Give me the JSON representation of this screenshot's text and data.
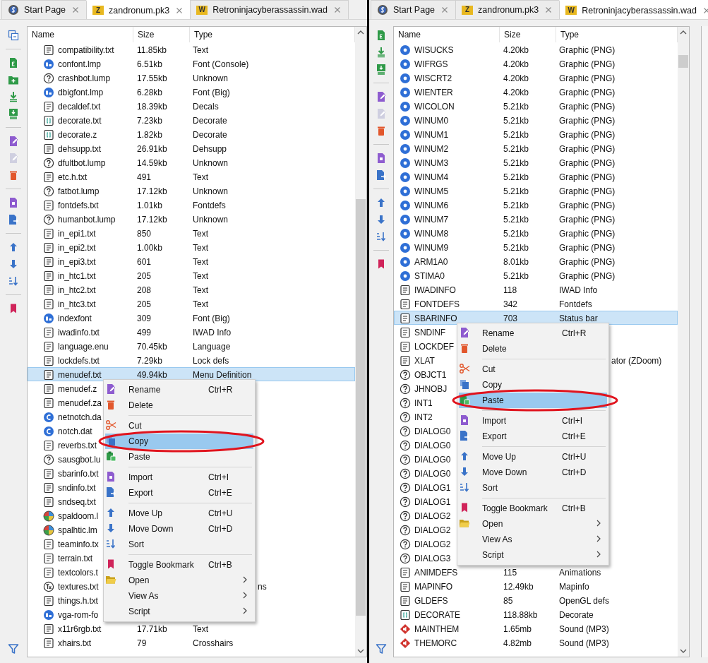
{
  "panels": [
    {
      "tabs": [
        {
          "kind": "start",
          "label": "Start Page",
          "selected": false
        },
        {
          "kind": "archive",
          "badge": "Z",
          "label": "zandronum.pk3",
          "selected": true
        },
        {
          "kind": "archive",
          "badge": "W",
          "label": "Retroninjacyberassassin.wad",
          "selected": false
        }
      ],
      "list": {
        "columns": [
          "Name",
          "Size",
          "Type"
        ],
        "rows": [
          {
            "kind": "text",
            "name": "compatibility.txt",
            "size": "11.85kb",
            "type": "Text",
            "selected": false
          },
          {
            "kind": "font",
            "name": "confont.lmp",
            "size": "6.51kb",
            "type": "Font (Console)",
            "selected": false
          },
          {
            "kind": "unknown",
            "name": "crashbot.lump",
            "size": "17.55kb",
            "type": "Unknown",
            "selected": false
          },
          {
            "kind": "font",
            "name": "dbigfont.lmp",
            "size": "6.28kb",
            "type": "Font (Big)",
            "selected": false
          },
          {
            "kind": "text",
            "name": "decaldef.txt",
            "size": "18.39kb",
            "type": "Decals",
            "selected": false
          },
          {
            "kind": "decorate",
            "name": "decorate.txt",
            "size": "7.23kb",
            "type": "Decorate",
            "selected": false
          },
          {
            "kind": "decorate",
            "name": "decorate.z",
            "size": "1.82kb",
            "type": "Decorate",
            "selected": false
          },
          {
            "kind": "text",
            "name": "dehsupp.txt",
            "size": "26.91kb",
            "type": "Dehsupp",
            "selected": false
          },
          {
            "kind": "unknown",
            "name": "dfultbot.lump",
            "size": "14.59kb",
            "type": "Unknown",
            "selected": false
          },
          {
            "kind": "text",
            "name": "etc.h.txt",
            "size": "491",
            "type": "Text",
            "selected": false
          },
          {
            "kind": "unknown",
            "name": "fatbot.lump",
            "size": "17.12kb",
            "type": "Unknown",
            "selected": false
          },
          {
            "kind": "text",
            "name": "fontdefs.txt",
            "size": "1.01kb",
            "type": "Fontdefs",
            "selected": false
          },
          {
            "kind": "unknown",
            "name": "humanbot.lump",
            "size": "17.12kb",
            "type": "Unknown",
            "selected": false
          },
          {
            "kind": "text",
            "name": "in_epi1.txt",
            "size": "850",
            "type": "Text",
            "selected": false
          },
          {
            "kind": "text",
            "name": "in_epi2.txt",
            "size": "1.00kb",
            "type": "Text",
            "selected": false
          },
          {
            "kind": "text",
            "name": "in_epi3.txt",
            "size": "601",
            "type": "Text",
            "selected": false
          },
          {
            "kind": "text",
            "name": "in_htc1.txt",
            "size": "205",
            "type": "Text",
            "selected": false
          },
          {
            "kind": "text",
            "name": "in_htc2.txt",
            "size": "208",
            "type": "Text",
            "selected": false
          },
          {
            "kind": "text",
            "name": "in_htc3.txt",
            "size": "205",
            "type": "Text",
            "selected": false
          },
          {
            "kind": "font",
            "name": "indexfont",
            "size": "309",
            "type": "Font (Big)",
            "selected": false
          },
          {
            "kind": "text",
            "name": "iwadinfo.txt",
            "size": "499",
            "type": "IWAD Info",
            "selected": false
          },
          {
            "kind": "text",
            "name": "language.enu",
            "size": "70.45kb",
            "type": "Language",
            "selected": false
          },
          {
            "kind": "text",
            "name": "lockdefs.txt",
            "size": "7.29kb",
            "type": "Lock defs",
            "selected": false
          },
          {
            "kind": "text",
            "name": "menudef.txt",
            "size": "49.94kb",
            "type": "Menu Definition",
            "selected": true
          },
          {
            "kind": "text",
            "name": "menudef.z",
            "selected": false
          },
          {
            "kind": "text",
            "name": "menudef.za",
            "selected": false
          },
          {
            "kind": "graphic",
            "name": "netnotch.da",
            "selected": false
          },
          {
            "kind": "graphic",
            "name": "notch.dat",
            "selected": false
          },
          {
            "kind": "text",
            "name": "reverbs.txt",
            "selected": false
          },
          {
            "kind": "unknown",
            "name": "sausgbot.lu",
            "selected": false
          },
          {
            "kind": "text",
            "name": "sbarinfo.txt",
            "selected": false
          },
          {
            "kind": "text",
            "name": "sndinfo.txt",
            "selected": false
          },
          {
            "kind": "text",
            "name": "sndseq.txt",
            "selected": false
          },
          {
            "kind": "palette",
            "name": "spaldoom.l",
            "selected": false
          },
          {
            "kind": "palette",
            "name": "spalhtic.lm",
            "selected": false
          },
          {
            "kind": "text",
            "name": "teaminfo.tx",
            "selected": false
          },
          {
            "kind": "text",
            "name": "terrain.txt",
            "selected": false
          },
          {
            "kind": "text",
            "name": "textcolors.t",
            "selected": false
          },
          {
            "kind": "textures",
            "name": "textures.txt",
            "type_end": "ns",
            "selected": false
          },
          {
            "kind": "text",
            "name": "things.h.txt",
            "selected": false
          },
          {
            "kind": "font",
            "name": "vga-rom-fo",
            "selected": false
          },
          {
            "kind": "text",
            "name": "x11r6rgb.txt",
            "size": "17.71kb",
            "type": "Text",
            "selected": false
          },
          {
            "kind": "text",
            "name": "xhairs.txt",
            "size": "79",
            "type": "Crosshairs",
            "selected": false
          }
        ]
      },
      "context_menu": {
        "items": [
          {
            "kind": "item",
            "label": "Rename",
            "shortcut": "Ctrl+R",
            "selected": false
          },
          {
            "kind": "item",
            "label": "Delete",
            "selected": false
          },
          {
            "kind": "separator"
          },
          {
            "kind": "item",
            "label": "Cut",
            "selected": false
          },
          {
            "kind": "item",
            "label": "Copy",
            "selected": true,
            "circled": true
          },
          {
            "kind": "item",
            "label": "Paste",
            "selected": false
          },
          {
            "kind": "separator"
          },
          {
            "kind": "item",
            "label": "Import",
            "shortcut": "Ctrl+I",
            "selected": false
          },
          {
            "kind": "item",
            "label": "Export",
            "shortcut": "Ctrl+E",
            "selected": false
          },
          {
            "kind": "separator"
          },
          {
            "kind": "item",
            "label": "Move Up",
            "shortcut": "Ctrl+U",
            "selected": false
          },
          {
            "kind": "item",
            "label": "Move Down",
            "shortcut": "Ctrl+D",
            "selected": false
          },
          {
            "kind": "item",
            "label": "Sort",
            "selected": false
          },
          {
            "kind": "separator"
          },
          {
            "kind": "item",
            "label": "Toggle Bookmark",
            "shortcut": "Ctrl+B",
            "selected": false
          },
          {
            "kind": "item",
            "label": "Open",
            "submenu": true,
            "selected": false
          },
          {
            "kind": "item",
            "label": "View As",
            "submenu": true,
            "selected": false
          },
          {
            "kind": "item",
            "label": "Script",
            "submenu": true,
            "selected": false
          }
        ]
      }
    },
    {
      "tabs": [
        {
          "kind": "start",
          "label": "Start Page",
          "selected": false
        },
        {
          "kind": "archive",
          "badge": "Z",
          "label": "zandronum.pk3",
          "selected": false
        },
        {
          "kind": "archive",
          "badge": "W",
          "label": "Retroninjacyberassassin.wad",
          "selected": true
        }
      ],
      "list": {
        "columns": [
          "Name",
          "Size",
          "Type"
        ],
        "rows": [
          {
            "kind": "png",
            "name": "WISUCKS",
            "size": "4.20kb",
            "type": "Graphic (PNG)",
            "selected": false
          },
          {
            "kind": "png",
            "name": "WIFRGS",
            "size": "4.20kb",
            "type": "Graphic (PNG)",
            "selected": false
          },
          {
            "kind": "png",
            "name": "WISCRT2",
            "size": "4.20kb",
            "type": "Graphic (PNG)",
            "selected": false
          },
          {
            "kind": "png",
            "name": "WIENTER",
            "size": "4.20kb",
            "type": "Graphic (PNG)",
            "selected": false
          },
          {
            "kind": "png",
            "name": "WICOLON",
            "size": "5.21kb",
            "type": "Graphic (PNG)",
            "selected": false
          },
          {
            "kind": "png",
            "name": "WINUM0",
            "size": "5.21kb",
            "type": "Graphic (PNG)",
            "selected": false
          },
          {
            "kind": "png",
            "name": "WINUM1",
            "size": "5.21kb",
            "type": "Graphic (PNG)",
            "selected": false
          },
          {
            "kind": "png",
            "name": "WINUM2",
            "size": "5.21kb",
            "type": "Graphic (PNG)",
            "selected": false
          },
          {
            "kind": "png",
            "name": "WINUM3",
            "size": "5.21kb",
            "type": "Graphic (PNG)",
            "selected": false
          },
          {
            "kind": "png",
            "name": "WINUM4",
            "size": "5.21kb",
            "type": "Graphic (PNG)",
            "selected": false
          },
          {
            "kind": "png",
            "name": "WINUM5",
            "size": "5.21kb",
            "type": "Graphic (PNG)",
            "selected": false
          },
          {
            "kind": "png",
            "name": "WINUM6",
            "size": "5.21kb",
            "type": "Graphic (PNG)",
            "selected": false
          },
          {
            "kind": "png",
            "name": "WINUM7",
            "size": "5.21kb",
            "type": "Graphic (PNG)",
            "selected": false
          },
          {
            "kind": "png",
            "name": "WINUM8",
            "size": "5.21kb",
            "type": "Graphic (PNG)",
            "selected": false
          },
          {
            "kind": "png",
            "name": "WINUM9",
            "size": "5.21kb",
            "type": "Graphic (PNG)",
            "selected": false
          },
          {
            "kind": "png",
            "name": "ARM1A0",
            "size": "8.01kb",
            "type": "Graphic (PNG)",
            "selected": false
          },
          {
            "kind": "png",
            "name": "STIMA0",
            "size": "5.21kb",
            "type": "Graphic (PNG)",
            "selected": false
          },
          {
            "kind": "text",
            "name": "IWADINFO",
            "size": "118",
            "type": "IWAD Info",
            "selected": false
          },
          {
            "kind": "text",
            "name": "FONTDEFS",
            "size": "342",
            "type": "Fontdefs",
            "selected": false
          },
          {
            "kind": "text",
            "name": "SBARINFO",
            "size": "703",
            "type": "Status bar",
            "selected": true
          },
          {
            "kind": "text",
            "name": "SNDINF",
            "selected": false
          },
          {
            "kind": "text",
            "name": "LOCKDEF",
            "selected": false
          },
          {
            "kind": "text",
            "name": "XLAT",
            "type_end": "ator (ZDoom)",
            "selected": false
          },
          {
            "kind": "unknown",
            "name": "OBJCT1",
            "selected": false
          },
          {
            "kind": "unknown",
            "name": "JHNOBJ",
            "selected": false
          },
          {
            "kind": "unknown",
            "name": "INT1",
            "selected": false
          },
          {
            "kind": "unknown",
            "name": "INT2",
            "selected": false
          },
          {
            "kind": "unknown",
            "name": "DIALOG0",
            "selected": false
          },
          {
            "kind": "unknown",
            "name": "DIALOG0",
            "selected": false
          },
          {
            "kind": "unknown",
            "name": "DIALOG0",
            "selected": false
          },
          {
            "kind": "unknown",
            "name": "DIALOG0",
            "selected": false
          },
          {
            "kind": "unknown",
            "name": "DIALOG1",
            "selected": false
          },
          {
            "kind": "unknown",
            "name": "DIALOG1",
            "selected": false
          },
          {
            "kind": "unknown",
            "name": "DIALOG2",
            "selected": false
          },
          {
            "kind": "unknown",
            "name": "DIALOG2",
            "selected": false
          },
          {
            "kind": "unknown",
            "name": "DIALOG2",
            "selected": false
          },
          {
            "kind": "unknown",
            "name": "DIALOG3",
            "selected": false
          },
          {
            "kind": "text",
            "name": "ANIMDEFS",
            "size": "115",
            "type": "Animations",
            "selected": false
          },
          {
            "kind": "text",
            "name": "MAPINFO",
            "size": "12.49kb",
            "type": "Mapinfo",
            "selected": false
          },
          {
            "kind": "text",
            "name": "GLDEFS",
            "size": "85",
            "type": "OpenGL defs",
            "selected": false
          },
          {
            "kind": "decorate",
            "name": "DECORATE",
            "size": "118.88kb",
            "type": "Decorate",
            "selected": false
          },
          {
            "kind": "sound",
            "name": "MAINTHEM",
            "size": "1.65mb",
            "type": "Sound (MP3)",
            "selected": false
          },
          {
            "kind": "sound",
            "name": "THEMORC",
            "size": "4.82mb",
            "type": "Sound (MP3)",
            "selected": false
          }
        ]
      },
      "context_menu": {
        "items": [
          {
            "kind": "item",
            "label": "Rename",
            "shortcut": "Ctrl+R",
            "selected": false
          },
          {
            "kind": "item",
            "label": "Delete",
            "selected": false
          },
          {
            "kind": "separator"
          },
          {
            "kind": "item",
            "label": "Cut",
            "selected": false
          },
          {
            "kind": "item",
            "label": "Copy",
            "selected": false
          },
          {
            "kind": "item",
            "label": "Paste",
            "selected": true,
            "circled": true
          },
          {
            "kind": "separator"
          },
          {
            "kind": "item",
            "label": "Import",
            "shortcut": "Ctrl+I",
            "selected": false
          },
          {
            "kind": "item",
            "label": "Export",
            "shortcut": "Ctrl+E",
            "selected": false
          },
          {
            "kind": "separator"
          },
          {
            "kind": "item",
            "label": "Move Up",
            "shortcut": "Ctrl+U",
            "selected": false
          },
          {
            "kind": "item",
            "label": "Move Down",
            "shortcut": "Ctrl+D",
            "selected": false
          },
          {
            "kind": "item",
            "label": "Sort",
            "selected": false
          },
          {
            "kind": "separator"
          },
          {
            "kind": "item",
            "label": "Toggle Bookmark",
            "shortcut": "Ctrl+B",
            "selected": false
          },
          {
            "kind": "item",
            "label": "Open",
            "submenu": true,
            "selected": false
          },
          {
            "kind": "item",
            "label": "View As",
            "submenu": true,
            "selected": false
          },
          {
            "kind": "item",
            "label": "Script",
            "submenu": true,
            "selected": false
          }
        ]
      }
    }
  ]
}
